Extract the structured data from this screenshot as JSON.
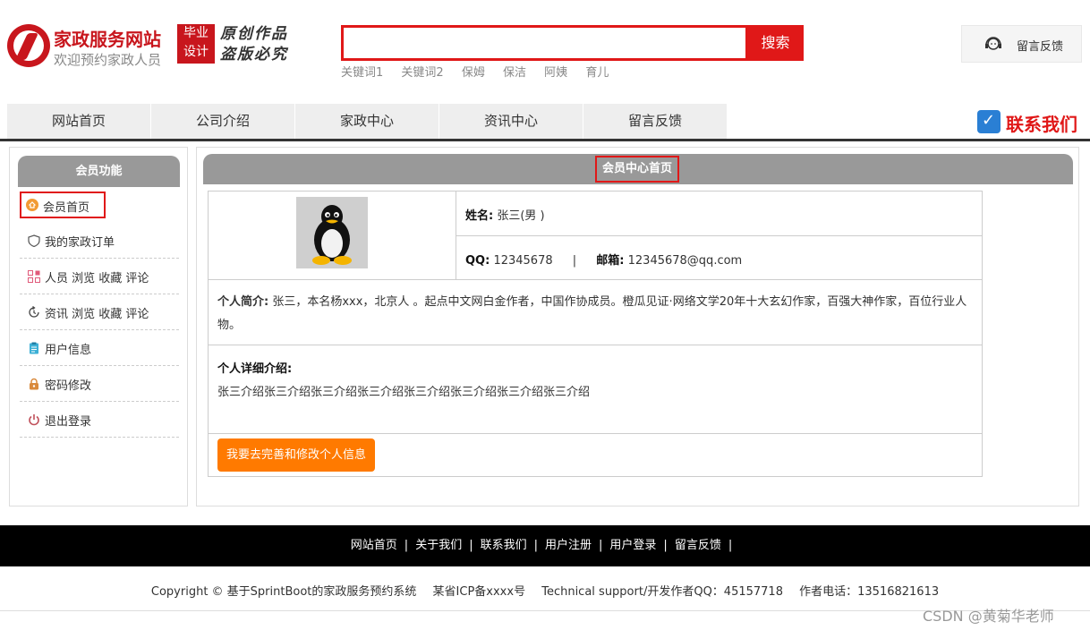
{
  "header": {
    "site_title": "家政服务网站",
    "site_subtitle": "欢迎预约家政人员",
    "badge_line1": "毕业",
    "badge_line2": "设计",
    "slogan_line1": "原创作品",
    "slogan_line2": "盗版必究",
    "search_placeholder": "",
    "search_button": "搜索",
    "keywords": [
      "关键词1",
      "关键词2",
      "保姆",
      "保洁",
      "阿姨",
      "育儿"
    ],
    "feedback_label": "留言反馈"
  },
  "nav": {
    "items": [
      "网站首页",
      "公司介绍",
      "家政中心",
      "资讯中心",
      "留言反馈"
    ],
    "contact_label": "联系我们"
  },
  "sidebar": {
    "title": "会员功能",
    "items": [
      {
        "label": "会员首页",
        "icon": "home-icon"
      },
      {
        "label": "我的家政订单",
        "icon": "shield-icon"
      },
      {
        "label": "人员 浏览 收藏 评论",
        "icon": "grid-icon"
      },
      {
        "label": "资讯 浏览 收藏 评论",
        "icon": "refresh-icon"
      },
      {
        "label": "用户信息",
        "icon": "clipboard-icon"
      },
      {
        "label": "密码修改",
        "icon": "lock-icon"
      },
      {
        "label": "退出登录",
        "icon": "power-icon"
      }
    ]
  },
  "main": {
    "title": "会员中心首页",
    "name_label": "姓名:",
    "name_value": "张三(男 )",
    "qq_label": "QQ:",
    "qq_value": "12345678",
    "separator": "|",
    "email_label": "邮箱:",
    "email_value": "12345678@qq.com",
    "intro_label": "个人简介:",
    "intro_value": "张三，本名杨xxx，北京人 。起点中文网白金作者，中国作协成员。橙瓜见证·网络文学20年十大玄幻作家，百强大神作家，百位行业人物。",
    "detail_label": "个人详细介绍:",
    "detail_value": "张三介绍张三介绍张三介绍张三介绍张三介绍张三介绍张三介绍张三介绍",
    "edit_button": "我要去完善和修改个人信息"
  },
  "footer": {
    "links": [
      "网站首页",
      "关于我们",
      "联系我们",
      "用户注册",
      "用户登录",
      "留言反馈"
    ],
    "pipe": "|",
    "copyright": "Copyright © 基于SprintBoot的家政服务预约系统",
    "icp": "某省ICP备xxxx号",
    "support": "Technical support/开发作者QQ：45157718",
    "phone": "作者电话：13516821613",
    "watermark": "CSDN @黄菊华老师"
  },
  "colors": {
    "brand_red": "#c8161d",
    "search_red": "#e01818",
    "header_gray": "#999999",
    "button_orange": "#ff7a00"
  }
}
